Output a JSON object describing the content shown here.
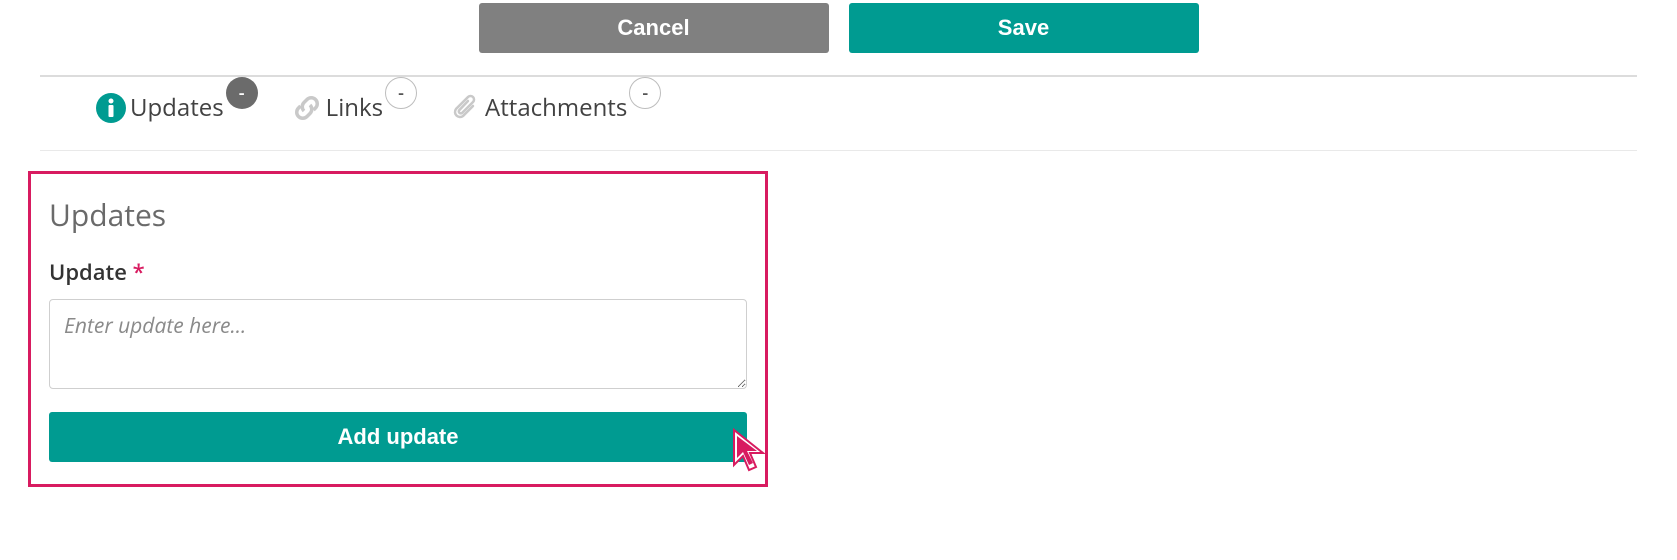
{
  "actions": {
    "cancel_label": "Cancel",
    "save_label": "Save"
  },
  "tabs": [
    {
      "label": "Updates",
      "badge": "-",
      "active": true
    },
    {
      "label": "Links",
      "badge": "-",
      "active": false
    },
    {
      "label": "Attachments",
      "badge": "-",
      "active": false
    }
  ],
  "updates_panel": {
    "title": "Updates",
    "field_label": "Update",
    "required_marker": "*",
    "textarea_placeholder": "Enter update here...",
    "add_button_label": "Add update"
  },
  "colors": {
    "accent": "#009b91",
    "highlight": "#d81b60",
    "cancel_gray": "#808080"
  }
}
